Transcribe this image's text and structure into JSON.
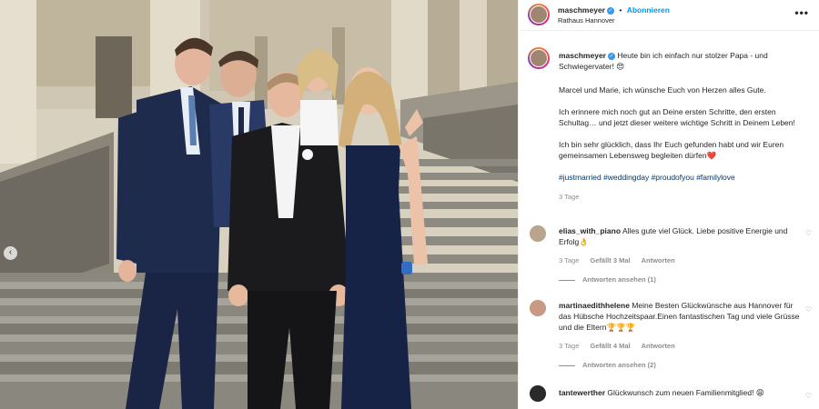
{
  "post": {
    "author": "maschmeyer",
    "location": "Rathaus Hannover",
    "follow_label": "Abonnieren",
    "more_label": "•••",
    "verified_mark": "✓"
  },
  "caption": {
    "author": "maschmeyer",
    "line1": "Heute bin ich einfach nur stolzer Papa - und Schwiegervater! 😍",
    "para2": "Marcel und Marie, ich wünsche Euch von Herzen alles Gute.",
    "para3": "Ich erinnere mich noch gut an Deine ersten Schritte, den ersten Schultag… und jetzt dieser weitere wichtige Schritt in Deinem Leben!",
    "para4": "Ich bin sehr glücklich, dass Ihr Euch gefunden habt und wir Euren gemeinsamen Lebensweg begleiten dürfen❤️",
    "hashtags": "#justmarried #weddingday #proudofyou #familylove",
    "time": "3 Tage"
  },
  "comments": [
    {
      "user": "elias_with_piano",
      "text": "Alles gute viel Glück. Liebe positive Energie und Erfolg👌",
      "time": "3 Tage",
      "likes": "Gefällt 3 Mal",
      "reply": "Antworten",
      "view_replies": "Antworten ansehen (1)"
    },
    {
      "user": "martinaedithhelene",
      "text": "Meine Besten Glückwünsche aus Hannover für das Hübsche Hochzeitspaar.Einen fantastischen Tag und viele Grüsse und die Eltern🏆🏆🏆",
      "time": "3 Tage",
      "likes": "Gefällt 4 Mal",
      "reply": "Antworten",
      "view_replies": "Antworten ansehen (2)"
    },
    {
      "user": "tantewerther",
      "text": "Glückwunsch zum neuen Familienmitglied! 😩"
    }
  ],
  "icons": {
    "heart": "♡",
    "prev": "‹"
  },
  "colors": {
    "link_blue": "#0095f6",
    "hashtag": "#00376b",
    "muted": "#8e8e8e"
  }
}
